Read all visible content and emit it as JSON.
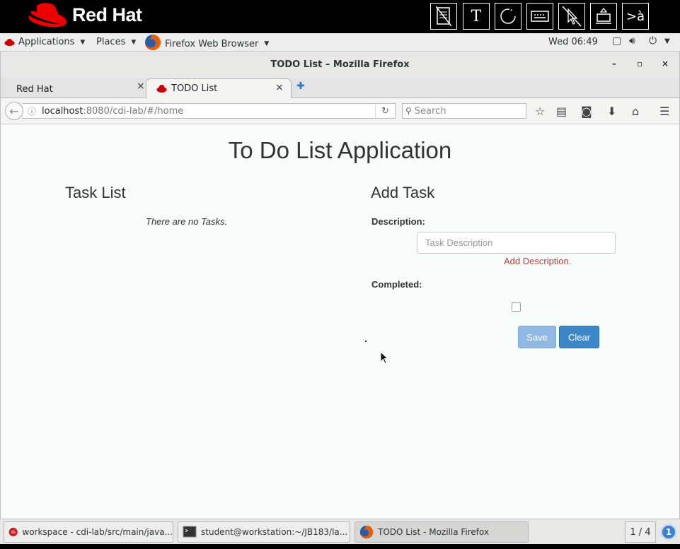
{
  "banner": {
    "brand": "Red Hat",
    "tools": [
      {
        "icon": "document-icon"
      },
      {
        "icon": "text-tool-icon",
        "glyph": "T"
      },
      {
        "icon": "refresh-circle-icon"
      },
      {
        "icon": "keyboard-icon"
      },
      {
        "icon": "mouse-disabled-icon"
      },
      {
        "icon": "eject-icon"
      },
      {
        "icon": "translate-icon",
        "glyph": ">à"
      }
    ]
  },
  "gnome": {
    "applications": "Applications",
    "places": "Places",
    "firefox": "Firefox Web Browser",
    "clock": "Wed 06:49"
  },
  "window": {
    "title": "TODO List – Mozilla Firefox",
    "minimize": "–",
    "maximize": "▫",
    "close": "×"
  },
  "tabs": [
    {
      "label": "Red Hat",
      "close": "×"
    },
    {
      "label": "TODO List",
      "close": "×"
    }
  ],
  "newtab": "✚",
  "nav": {
    "url_host": "localhost",
    "url_rest": ":8080/cdi-lab/#/home",
    "search_placeholder": "Search"
  },
  "app": {
    "title": "To Do List Application",
    "task_list_heading": "Task List",
    "no_tasks": "There are no Tasks.",
    "add_task_heading": "Add Task",
    "description_label": "Description:",
    "description_placeholder": "Task Description",
    "description_value": "",
    "description_error": "Add Description.",
    "completed_label": "Completed:",
    "completed_checked": false,
    "save_label": "Save",
    "clear_label": "Clear"
  },
  "taskbar": {
    "items": [
      {
        "label": "workspace - cdi-lab/src/main/java..."
      },
      {
        "label": "student@workstation:~/JB183/la..."
      },
      {
        "label": "TODO List - Mozilla Firefox"
      }
    ],
    "pager": "1 / 4",
    "notifications": "1"
  },
  "colors": {
    "brand_red": "#ee0000",
    "primary_button": "#3c87c8",
    "disabled_button": "#8fb9e2",
    "error_text": "#a94442"
  }
}
